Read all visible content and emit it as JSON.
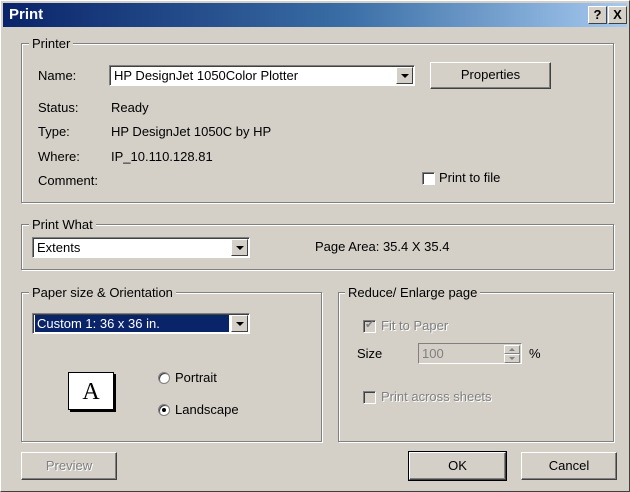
{
  "window": {
    "title": "Print",
    "help_glyph": "?",
    "close_glyph": "X"
  },
  "printer": {
    "group_label": "Printer",
    "name_label": "Name:",
    "name_value": "HP DesignJet 1050Color Plotter",
    "properties_label": "Properties",
    "status_label": "Status:",
    "status_value": "Ready",
    "type_label": "Type:",
    "type_value": "HP DesignJet 1050C by HP",
    "where_label": "Where:",
    "where_value": "IP_10.110.128.81",
    "comment_label": "Comment:",
    "print_to_file_label": "Print to file",
    "print_to_file_checked": false
  },
  "print_what": {
    "group_label": "Print What",
    "value": "Extents",
    "page_area": "Page Area: 35.4 X 35.4"
  },
  "paper": {
    "group_label": "Paper size & Orientation",
    "size_value": "Custom 1: 36 x 36 in.",
    "preview_letter": "A",
    "portrait_label": "Portrait",
    "landscape_label": "Landscape",
    "selected_orientation": "Landscape"
  },
  "reduce": {
    "group_label": "Reduce/ Enlarge page",
    "fit_to_paper_label": "Fit to Paper",
    "fit_to_paper_checked": true,
    "size_label": "Size",
    "size_value": "100",
    "percent_label": "%",
    "print_across_label": "Print across sheets",
    "print_across_checked": false
  },
  "buttons": {
    "preview": "Preview",
    "ok": "OK",
    "cancel": "Cancel"
  }
}
